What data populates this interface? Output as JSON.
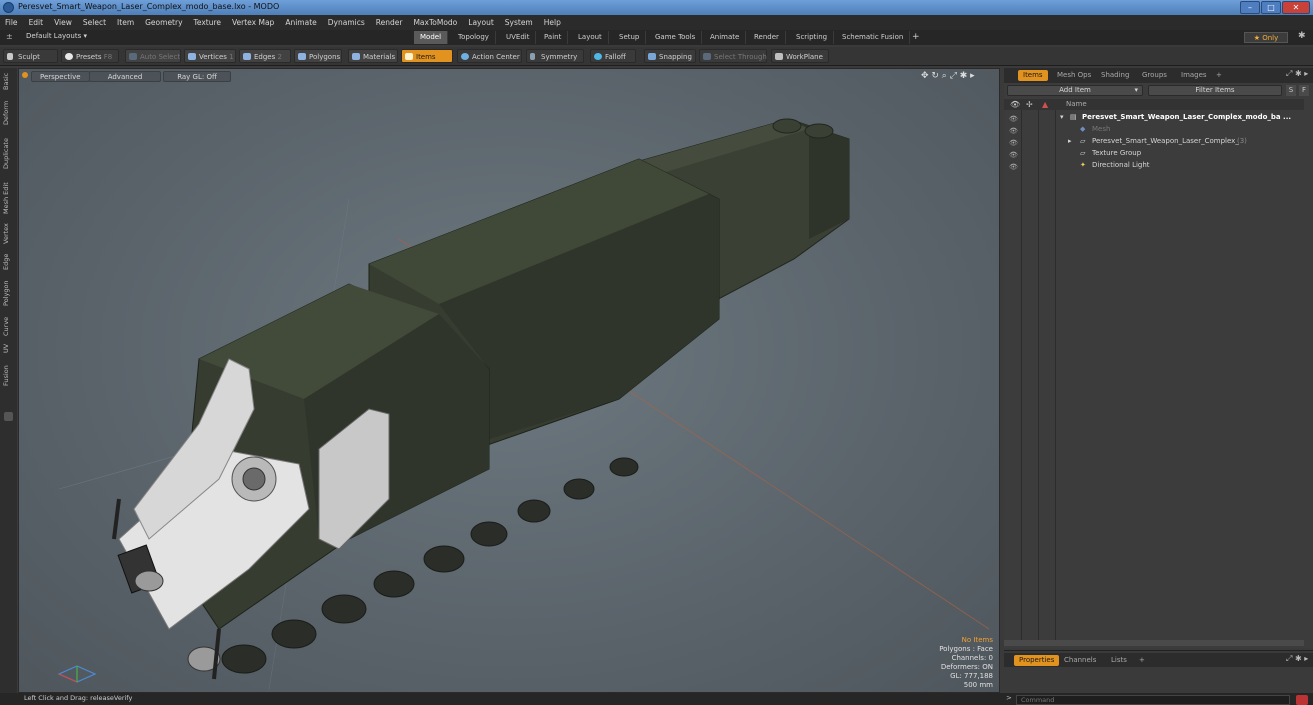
{
  "window": {
    "title": "Peresvet_Smart_Weapon_Laser_Complex_modo_base.lxo - MODO"
  },
  "menu": [
    "File",
    "Edit",
    "View",
    "Select",
    "Item",
    "Geometry",
    "Texture",
    "Vertex Map",
    "Animate",
    "Dynamics",
    "Render",
    "MaxToModo",
    "Layout",
    "System",
    "Help"
  ],
  "layout_selector": "Default Layouts ▾",
  "layout_tabs": [
    "Model",
    "Topology",
    "UVEdit",
    "Paint",
    "Layout",
    "Setup",
    "Game Tools",
    "Animate",
    "Render",
    "Scripting",
    "Schematic Fusion",
    "+"
  ],
  "layout_only": "★ Only",
  "toolbar": {
    "sculpt": "Sculpt",
    "presets": "Presets",
    "presets_key": "F8",
    "auto_select": "Auto Select",
    "vertices": "Vertices",
    "vertices_count": "1",
    "edges": "Edges",
    "edges_count": "2",
    "polygons": "Polygons",
    "materials": "Materials",
    "items": "Items",
    "action_center": "Action Center",
    "symmetry": "Symmetry",
    "falloff": "Falloff",
    "snapping": "Snapping",
    "select_through": "Select Through",
    "workplane": "WorkPlane"
  },
  "left_tabs": [
    "Basic",
    "Deform",
    "Duplicate",
    "Mesh Edit",
    "Vertex",
    "Edge",
    "Polygon",
    "Curve",
    "UV",
    "Fusion"
  ],
  "viewport": {
    "perspective": "Perspective",
    "advanced": "Advanced",
    "raygl": "Ray GL: Off",
    "stats": {
      "no_items": "No Items",
      "polygons": "Polygons : Face",
      "channels": "Channels: 0",
      "deformers": "Deformers: ON",
      "gl": "GL: 777,188",
      "size": "500 mm"
    }
  },
  "right_panel": {
    "tabs": [
      "Items",
      "Mesh Ops",
      "Shading",
      "Groups",
      "Images",
      "+"
    ],
    "add_item": "Add Item",
    "filter_items": "Filter Items",
    "btn_s": "S",
    "btn_f": "F",
    "column_name": "Name",
    "tree": [
      {
        "label": "Peresvet_Smart_Weapon_Laser_Complex_modo_ba ...",
        "bold": true
      },
      {
        "label": "Mesh",
        "dim": true
      },
      {
        "label": "Peresvet_Smart_Weapon_Laser_Complex_",
        "count": "(3)"
      },
      {
        "label": "Texture Group"
      },
      {
        "label": "Directional Light"
      }
    ]
  },
  "props_panel": {
    "tabs": [
      "Properties",
      "Channels",
      "Lists",
      "+"
    ]
  },
  "status": {
    "hint": "Left Click and Drag:  releaseVerify",
    "command_placeholder": "Command"
  },
  "colors": {
    "accent": "#e2921f",
    "vehicle_body": "#363c30"
  }
}
